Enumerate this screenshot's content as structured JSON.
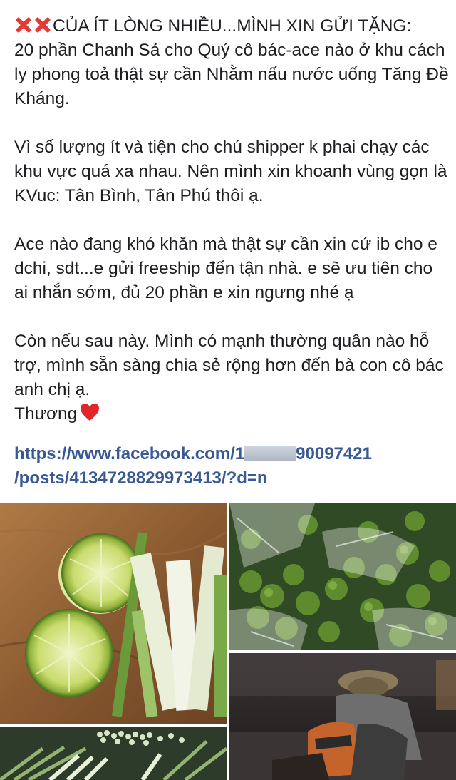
{
  "post": {
    "title_line": "CỦA ÍT LÒNG NHIỀU...MÌNH XIN GỬI TẶNG:",
    "intro": "20 phần Chanh Sả cho Quý cô bác-ace nào ở khu cách ly phong toả thật sự cần Nhằm nấu nước uống Tăng Đề Kháng.",
    "para2": "Vì số lượng ít và tiện cho chú shipper k phai chạy các khu vực quá xa nhau. Nên mình xin khoanh vùng gọn là KVuc: Tân Bình, Tân Phú thôi ạ.",
    "para3": "Ace nào đang khó khăn mà thật sự cần xin cứ ib cho e dchi, sdt...e gửi freeship đến tận nhà. e sẽ ưu tiên cho ai nhắn sớm, đủ 20 phần e xin ngưng nhé ạ",
    "para4": "Còn nếu sau này. Mình có mạnh thường quân nào hỗ trợ, mình sẵn sàng chia sẻ rộng hơn đến bà con cô bác anh chị ạ.",
    "closing": "Thương",
    "link_prefix": "https://www.facebook.com/1",
    "link_suffix": "90097421",
    "link_line2": "/posts/4134728829973413/?d=n"
  },
  "colors": {
    "link": "#385898",
    "x_emoji": "#e53935",
    "heart": "#e0262b"
  },
  "icons": [
    "cross-mark-icon",
    "cross-mark-icon",
    "red-heart-icon"
  ]
}
